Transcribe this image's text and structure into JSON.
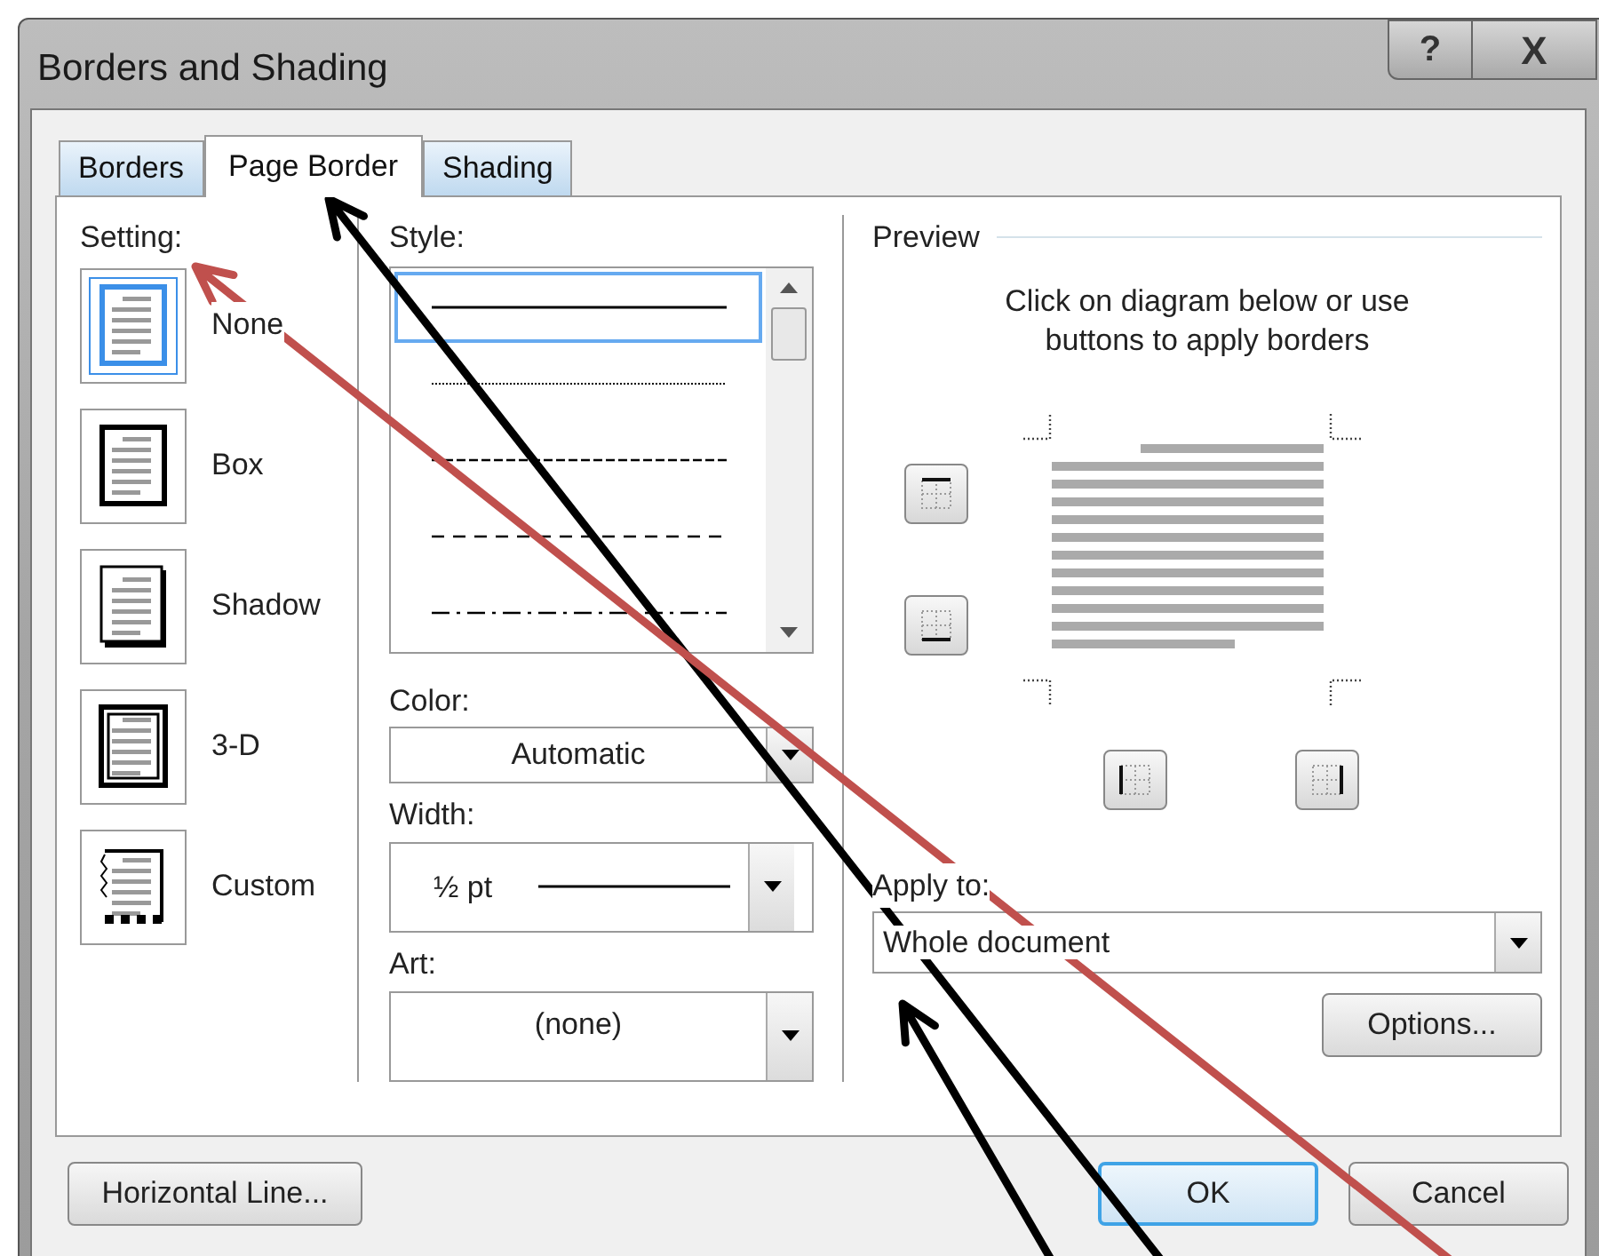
{
  "window": {
    "title": "Borders and Shading",
    "help_button": "?",
    "close_button": "X"
  },
  "tabs": [
    {
      "label": "Borders",
      "selected": false
    },
    {
      "label": "Page Border",
      "selected": true
    },
    {
      "label": "Shading",
      "selected": false
    }
  ],
  "setting": {
    "label": "Setting:",
    "options": [
      {
        "kind": "none",
        "label": "None",
        "selected": true
      },
      {
        "kind": "box",
        "label": "Box",
        "selected": false
      },
      {
        "kind": "shadow",
        "label": "Shadow",
        "selected": false
      },
      {
        "kind": "threed",
        "label": "3-D",
        "selected": false
      },
      {
        "kind": "custom",
        "label": "Custom",
        "selected": false
      }
    ]
  },
  "style": {
    "label": "Style:",
    "lines": [
      {
        "kind": "solid",
        "selected": true
      },
      {
        "kind": "dotted",
        "selected": false
      },
      {
        "kind": "fine-dash",
        "selected": false
      },
      {
        "kind": "dash",
        "selected": false
      },
      {
        "kind": "dash-dot",
        "selected": false
      }
    ]
  },
  "color": {
    "label": "Color:",
    "value": "Automatic"
  },
  "width": {
    "label": "Width:",
    "value": "½ pt"
  },
  "art": {
    "label": "Art:",
    "value": "(none)"
  },
  "preview": {
    "title": "Preview",
    "hint": "Click on diagram below or use buttons to apply borders"
  },
  "apply_to": {
    "label": "Apply to:",
    "value": "Whole document"
  },
  "buttons": {
    "options": "Options...",
    "horizontal_line": "Horizontal Line...",
    "ok": "OK",
    "cancel": "Cancel"
  },
  "annotation_arrows": [
    {
      "color": "#000000"
    },
    {
      "color": "#000000"
    },
    {
      "color": "#c0504d"
    }
  ]
}
